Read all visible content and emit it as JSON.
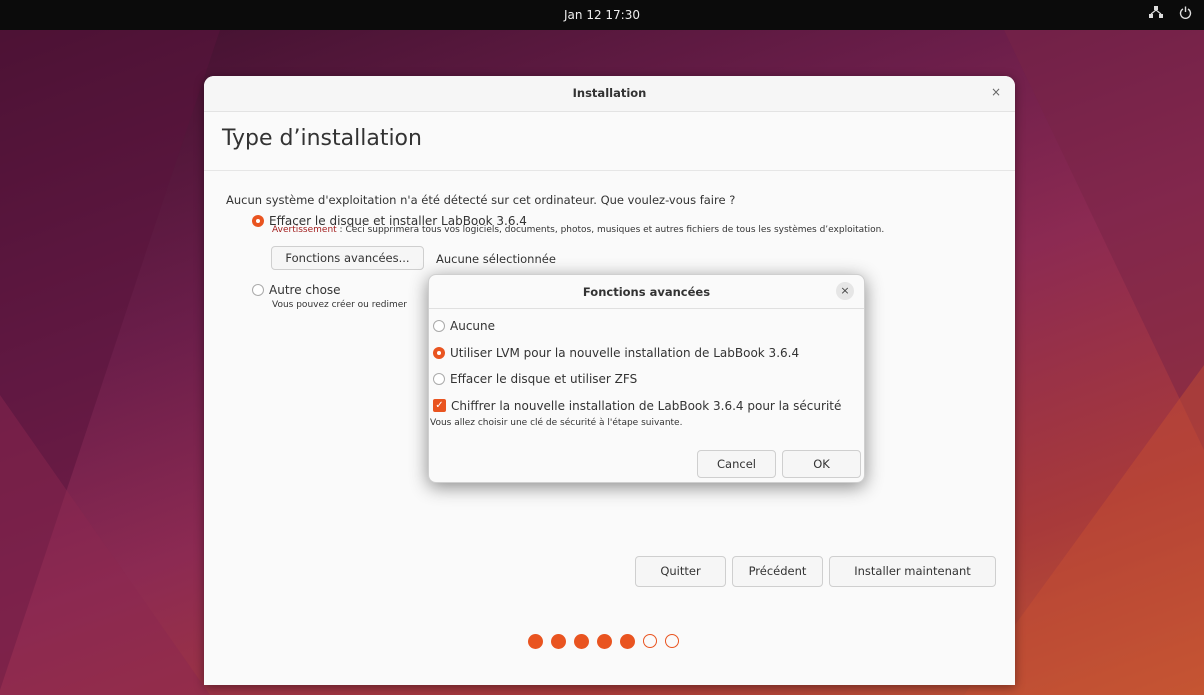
{
  "topbar": {
    "clock": "Jan 12  17:30",
    "network_icon": "network-icon",
    "power_icon": "power-icon"
  },
  "window": {
    "title": "Installation",
    "close_glyph": "×",
    "page_title": "Type d’installation",
    "question": "Aucun système d'exploitation n'a été détecté sur cet ordinateur. Que voulez-vous faire ?",
    "option_erase": {
      "label": "Effacer le disque et installer LabBook 3.6.4",
      "selected": true,
      "warning_label": "Avertissement",
      "warning_text": " : Ceci supprimera tous vos logiciels, documents, photos, musiques et autres fichiers de tous les systèmes d’exploitation."
    },
    "advanced_button": "Fonctions avancées...",
    "advanced_status": "Aucune sélectionnée",
    "option_other": {
      "label": "Autre chose",
      "selected": false,
      "sub": "Vous pouvez créer ou redimer"
    },
    "buttons": {
      "quit": "Quitter",
      "previous": "Précédent",
      "install": "Installer maintenant"
    },
    "progress": {
      "filled": 5,
      "total": 7
    }
  },
  "dialog": {
    "title": "Fonctions avancées",
    "close_glyph": "×",
    "options": [
      {
        "label": "Aucune",
        "selected": false
      },
      {
        "label": "Utiliser LVM pour la nouvelle installation de LabBook 3.6.4",
        "selected": true
      },
      {
        "label": "Effacer le disque et utiliser ZFS",
        "selected": false
      }
    ],
    "encrypt": {
      "label": "Chiffrer la nouvelle installation de LabBook 3.6.4 pour la sécurité",
      "checked": true,
      "sub": "Vous allez choisir une clé de sécurité à l'étape suivante."
    },
    "cancel": "Cancel",
    "ok": "OK"
  },
  "colors": {
    "accent": "#e95420"
  }
}
